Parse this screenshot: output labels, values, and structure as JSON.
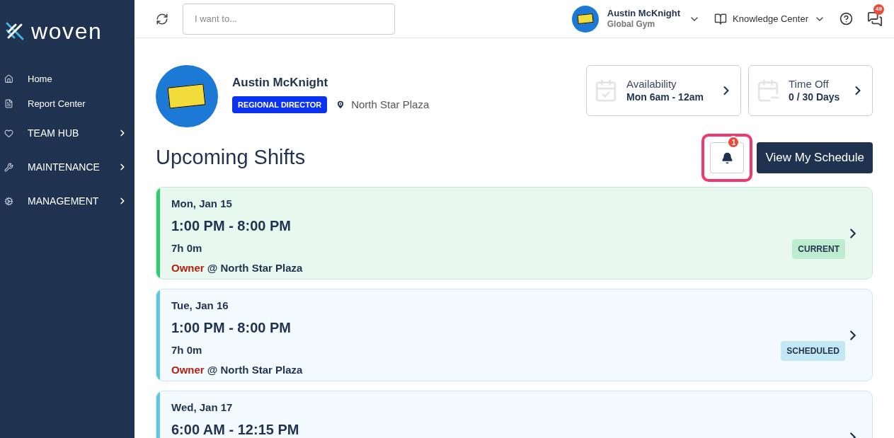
{
  "sidebar": {
    "logo": "woven",
    "items": [
      {
        "label": "Home",
        "kind": "link"
      },
      {
        "label": "Report Center",
        "kind": "link"
      },
      {
        "label": "TEAM HUB",
        "kind": "section"
      },
      {
        "label": "MAINTENANCE",
        "kind": "section"
      },
      {
        "label": "MANAGEMENT",
        "kind": "section"
      }
    ]
  },
  "topbar": {
    "search": {
      "placeholder": "I want to..."
    },
    "user": {
      "name": "Austin McKnight",
      "org": "Global Gym"
    },
    "knowledge_center": "Knowledge Center",
    "messages_badge": "49"
  },
  "profile": {
    "name": "Austin McKnight",
    "role": "REGIONAL DIRECTOR",
    "location": "North Star Plaza"
  },
  "summary_cards": [
    {
      "kind": "availability",
      "title": "Availability",
      "value": "Mon 6am - 12am"
    },
    {
      "kind": "time_off",
      "title": "Time Off",
      "value": "0 / 30 Days"
    }
  ],
  "section_title": "Upcoming Shifts",
  "notifications_badge": "1",
  "view_schedule_button": "View My Schedule",
  "shifts": [
    {
      "date": "Mon, Jan 15",
      "time": "1:00 PM - 8:00 PM",
      "duration": "7h 0m",
      "role": "Owner",
      "location": "@ North Star Plaza",
      "status": "CURRENT",
      "kind": "current"
    },
    {
      "date": "Tue, Jan 16",
      "time": "1:00 PM - 8:00 PM",
      "duration": "7h 0m",
      "role": "Owner",
      "location": "@ North Star Plaza",
      "status": "SCHEDULED",
      "kind": "scheduled"
    },
    {
      "date": "Wed, Jan 17",
      "time": "6:00 AM - 12:15 PM",
      "kind": "scheduled"
    }
  ]
}
